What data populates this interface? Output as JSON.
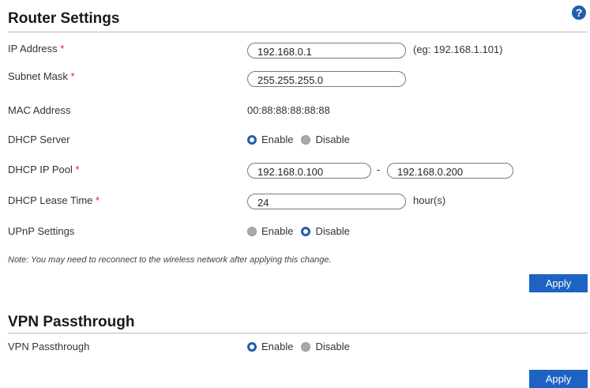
{
  "router": {
    "title": "Router Settings",
    "help_icon": "?",
    "ip_label": "IP Address",
    "ip_value": "192.168.0.1",
    "ip_hint": "(eg: 192.168.1.101)",
    "subnet_label": "Subnet Mask",
    "subnet_value": "255.255.255.0",
    "mac_label": "MAC Address",
    "mac_value": "00:88:88:88:88:88",
    "dhcp_label": "DHCP Server",
    "dhcp_enable": "Enable",
    "dhcp_disable": "Disable",
    "dhcp_selected": "Enable",
    "pool_label": "DHCP IP Pool",
    "pool_start": "192.168.0.100",
    "pool_separator": "-",
    "pool_end": "192.168.0.200",
    "lease_label": "DHCP Lease Time",
    "lease_value": "24",
    "lease_unit": "hour(s)",
    "upnp_label": "UPnP Settings",
    "upnp_enable": "Enable",
    "upnp_disable": "Disable",
    "upnp_selected": "Disable",
    "required_marker": "*",
    "note": "Note: You may need to reconnect to the wireless network after applying this change.",
    "apply_label": "Apply"
  },
  "vpn": {
    "title": "VPN Passthrough",
    "label": "VPN Passthrough",
    "enable": "Enable",
    "disable": "Disable",
    "selected": "Enable",
    "apply_label": "Apply"
  },
  "colors": {
    "accent": "#1e63c4",
    "required": "#e0251c",
    "radio_off": "#a9a9a9"
  }
}
